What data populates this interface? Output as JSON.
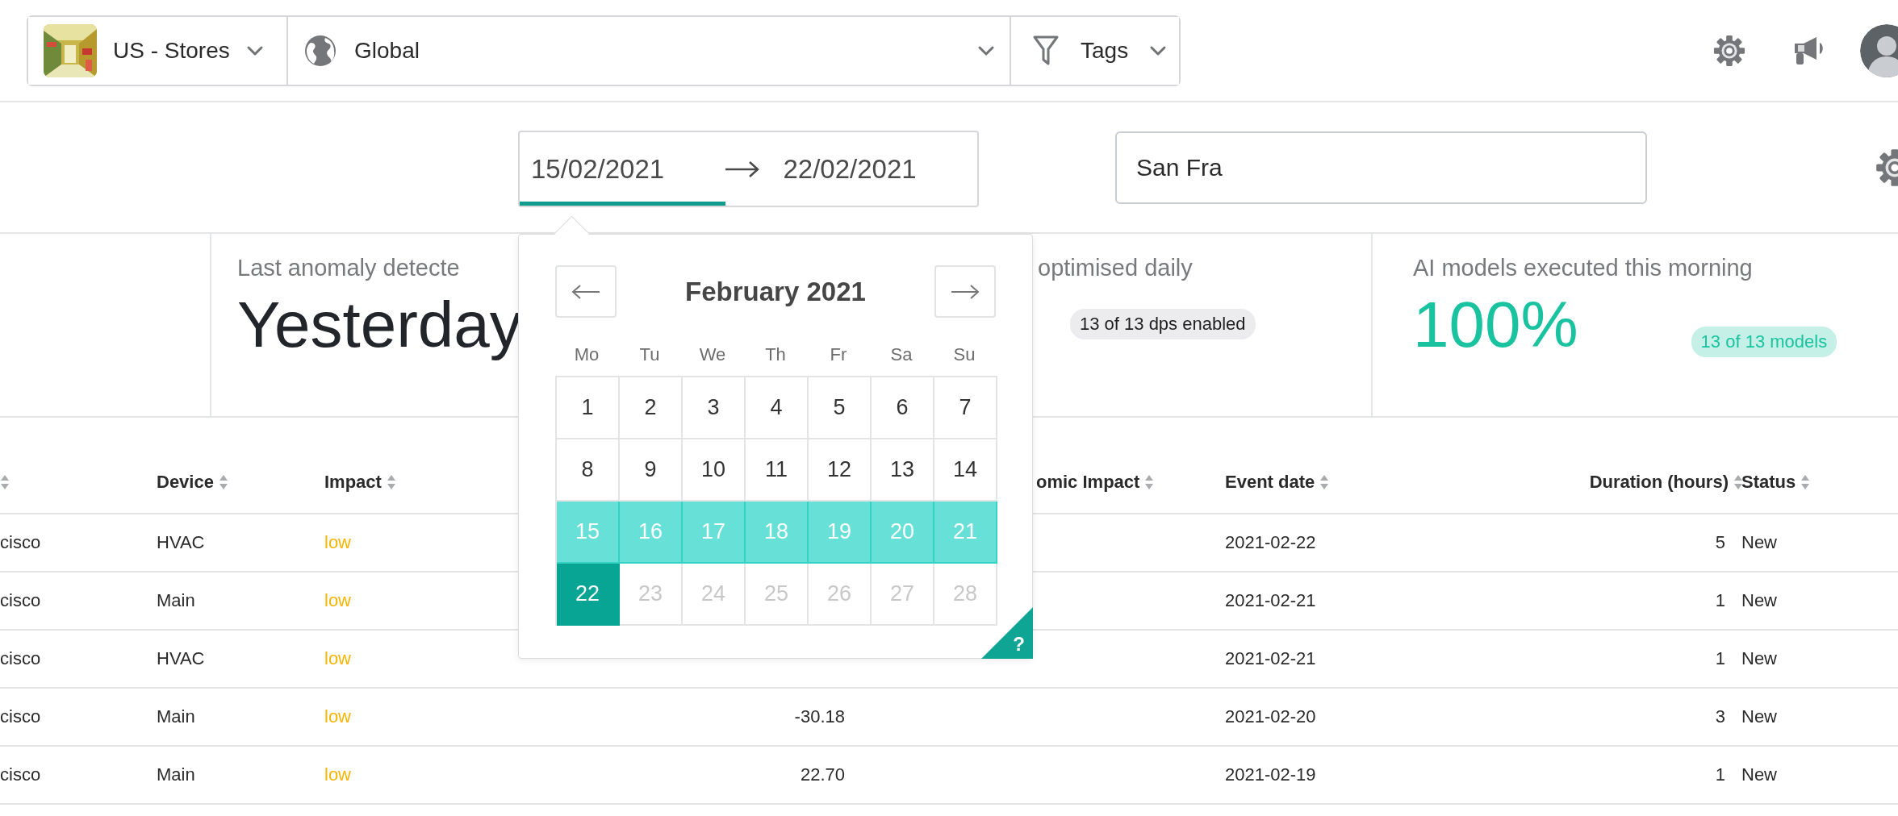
{
  "topbar": {
    "store": {
      "label": "US - Stores"
    },
    "region": {
      "label": "Global"
    },
    "tags": {
      "label": "Tags"
    }
  },
  "date_range": {
    "fields": [
      {
        "value": "15/02/2021",
        "selected": true
      },
      {
        "value": "22/02/2021",
        "selected": false
      }
    ]
  },
  "search": {
    "value": "San Fra"
  },
  "cards": [
    {
      "title": "Last anomaly detecte",
      "value": "Yesterday",
      "color": "#22252a"
    },
    {
      "title": "optimised daily",
      "badge": "13 of 13 dps enabled",
      "color": "#ececee"
    },
    {
      "title": "AI models executed this morning",
      "value": "100%",
      "badge": "13 of 13 models",
      "color": "#19c3a0"
    }
  ],
  "table": {
    "header": {
      "column_1": {
        "sortable": true
      },
      "device": {
        "label": "Device",
        "sortable": true
      },
      "impact": {
        "label": "Impact",
        "sortable": true
      },
      "economic_impact": {
        "label": "omic Impact",
        "sortable": true
      },
      "event_date": {
        "label": "Event date",
        "sortable": true
      },
      "duration": {
        "label": "Duration (hours)",
        "sortable": true
      },
      "status": {
        "label": "Status",
        "sortable": true
      }
    },
    "rows": [
      {
        "column_1": "cisco",
        "device": "HVAC",
        "impact": "low",
        "event_date": "2021-02-22",
        "duration": "5",
        "status": "New"
      },
      {
        "column_1": "cisco",
        "device": "Main",
        "impact": "low",
        "event_date": "2021-02-21",
        "duration": "1",
        "status": "New"
      },
      {
        "column_1": "cisco",
        "device": "HVAC",
        "impact": "low",
        "event_date": "2021-02-21",
        "duration": "1",
        "status": "New"
      },
      {
        "column_1": "cisco",
        "device": "Main",
        "impact": "low",
        "column_4": "-30.18",
        "event_date": "2021-02-20",
        "duration": "3",
        "status": "New"
      },
      {
        "column_1": "cisco",
        "device": "Main",
        "impact": "low",
        "column_4": "22.70",
        "event_date": "2021-02-19",
        "duration": "1",
        "status": "New"
      }
    ]
  },
  "calendar": {
    "title": "February 2021",
    "weekdays": [
      "Mo",
      "Tu",
      "We",
      "Th",
      "Fr",
      "Sa",
      "Su"
    ],
    "help": "?",
    "days": [
      {
        "label": "1",
        "in_range": false,
        "selected": false,
        "disabled": false
      },
      {
        "label": "2",
        "in_range": false,
        "selected": false,
        "disabled": false
      },
      {
        "label": "3",
        "in_range": false,
        "selected": false,
        "disabled": false
      },
      {
        "label": "4",
        "in_range": false,
        "selected": false,
        "disabled": false
      },
      {
        "label": "5",
        "in_range": false,
        "selected": false,
        "disabled": false
      },
      {
        "label": "6",
        "in_range": false,
        "selected": false,
        "disabled": false
      },
      {
        "label": "7",
        "in_range": false,
        "selected": false,
        "disabled": false
      },
      {
        "label": "8",
        "in_range": false,
        "selected": false,
        "disabled": false
      },
      {
        "label": "9",
        "in_range": false,
        "selected": false,
        "disabled": false
      },
      {
        "label": "10",
        "in_range": false,
        "selected": false,
        "disabled": false
      },
      {
        "label": "11",
        "in_range": false,
        "selected": false,
        "disabled": false
      },
      {
        "label": "12",
        "in_range": false,
        "selected": false,
        "disabled": false
      },
      {
        "label": "13",
        "in_range": false,
        "selected": false,
        "disabled": false
      },
      {
        "label": "14",
        "in_range": false,
        "selected": false,
        "disabled": false
      },
      {
        "label": "15",
        "in_range": true,
        "selected": false,
        "disabled": false
      },
      {
        "label": "16",
        "in_range": true,
        "selected": false,
        "disabled": false
      },
      {
        "label": "17",
        "in_range": true,
        "selected": false,
        "disabled": false
      },
      {
        "label": "18",
        "in_range": true,
        "selected": false,
        "disabled": false
      },
      {
        "label": "19",
        "in_range": true,
        "selected": false,
        "disabled": false
      },
      {
        "label": "20",
        "in_range": true,
        "selected": false,
        "disabled": false
      },
      {
        "label": "21",
        "in_range": true,
        "selected": false,
        "disabled": false
      },
      {
        "label": "22",
        "in_range": false,
        "selected": true,
        "disabled": false
      },
      {
        "label": "23",
        "in_range": false,
        "selected": false,
        "disabled": true
      },
      {
        "label": "24",
        "in_range": false,
        "selected": false,
        "disabled": true
      },
      {
        "label": "25",
        "in_range": false,
        "selected": false,
        "disabled": true
      },
      {
        "label": "26",
        "in_range": false,
        "selected": false,
        "disabled": true
      },
      {
        "label": "27",
        "in_range": false,
        "selected": false,
        "disabled": true
      },
      {
        "label": "28",
        "in_range": false,
        "selected": false,
        "disabled": true
      }
    ]
  }
}
